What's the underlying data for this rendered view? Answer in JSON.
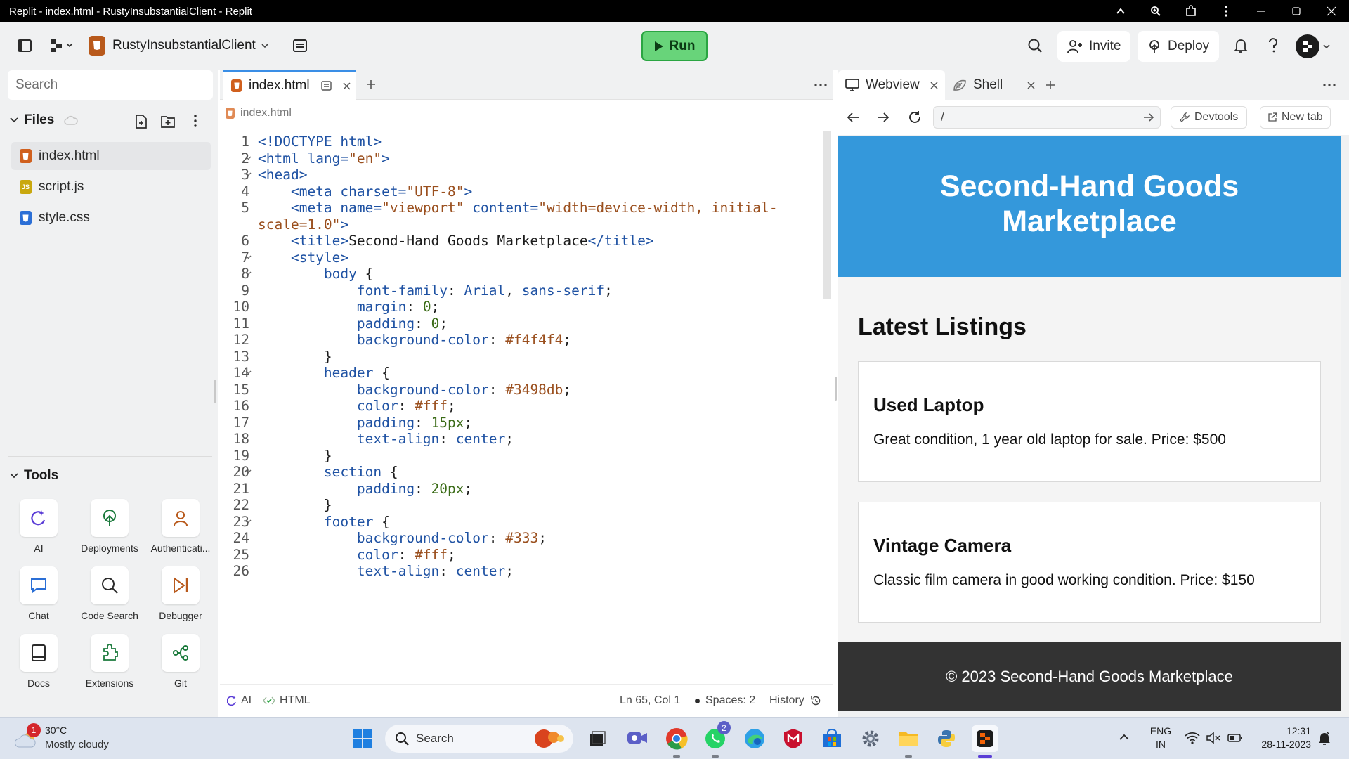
{
  "os": {
    "window_title": "Replit - index.html - RustyInsubstantialClient - Replit"
  },
  "header": {
    "project_name": "RustyInsubstantialClient",
    "run_label": "Run",
    "invite_label": "Invite",
    "deploy_label": "Deploy"
  },
  "sidebar": {
    "search_placeholder": "Search",
    "files_label": "Files",
    "files": [
      {
        "name": "index.html",
        "type": "html"
      },
      {
        "name": "script.js",
        "type": "js"
      },
      {
        "name": "style.css",
        "type": "css"
      }
    ],
    "tools_label": "Tools",
    "tools": [
      {
        "label": "AI",
        "icon": "ai-icon"
      },
      {
        "label": "Deployments",
        "icon": "deployments-icon"
      },
      {
        "label": "Authenticati...",
        "icon": "authentication-icon"
      },
      {
        "label": "Chat",
        "icon": "chat-icon"
      },
      {
        "label": "Code Search",
        "icon": "code-search-icon"
      },
      {
        "label": "Debugger",
        "icon": "debugger-icon"
      },
      {
        "label": "Docs",
        "icon": "docs-icon"
      },
      {
        "label": "Extensions",
        "icon": "extensions-icon"
      },
      {
        "label": "Git",
        "icon": "git-icon"
      }
    ]
  },
  "editor": {
    "tab_label": "index.html",
    "breadcrumb": "index.html",
    "lines": [
      {
        "n": "1",
        "fold": false
      },
      {
        "n": "2",
        "fold": true
      },
      {
        "n": "3",
        "fold": true
      },
      {
        "n": "4",
        "fold": false
      },
      {
        "n": "5",
        "fold": false
      },
      {
        "n": "",
        "fold": false
      },
      {
        "n": "6",
        "fold": false
      },
      {
        "n": "7",
        "fold": true
      },
      {
        "n": "8",
        "fold": true
      },
      {
        "n": "9",
        "fold": false
      },
      {
        "n": "10",
        "fold": false
      },
      {
        "n": "11",
        "fold": false
      },
      {
        "n": "12",
        "fold": false
      },
      {
        "n": "13",
        "fold": false
      },
      {
        "n": "14",
        "fold": true
      },
      {
        "n": "15",
        "fold": false
      },
      {
        "n": "16",
        "fold": false
      },
      {
        "n": "17",
        "fold": false
      },
      {
        "n": "18",
        "fold": false
      },
      {
        "n": "19",
        "fold": false
      },
      {
        "n": "20",
        "fold": true
      },
      {
        "n": "21",
        "fold": false
      },
      {
        "n": "22",
        "fold": false
      },
      {
        "n": "23",
        "fold": true
      },
      {
        "n": "24",
        "fold": false
      },
      {
        "n": "25",
        "fold": false
      },
      {
        "n": "26",
        "fold": false
      }
    ],
    "code": [
      [
        [
          "tag",
          "<!DOCTYPE html>"
        ]
      ],
      [
        [
          "tag",
          "<html "
        ],
        [
          "attr",
          "lang="
        ],
        [
          "str",
          "\"en\""
        ],
        [
          "tag",
          ">"
        ]
      ],
      [
        [
          "tag",
          "<head>"
        ]
      ],
      [
        [
          "txt",
          "    "
        ],
        [
          "tag",
          "<meta "
        ],
        [
          "attr",
          "charset="
        ],
        [
          "str",
          "\"UTF-8\""
        ],
        [
          "tag",
          ">"
        ]
      ],
      [
        [
          "txt",
          "    "
        ],
        [
          "tag",
          "<meta "
        ],
        [
          "attr",
          "name="
        ],
        [
          "str",
          "\"viewport\" "
        ],
        [
          "attr",
          "content="
        ],
        [
          "str",
          "\"width=device-width, initial-"
        ]
      ],
      [
        [
          "str",
          "scale=1.0\""
        ],
        [
          "tag",
          ">"
        ]
      ],
      [
        [
          "txt",
          "    "
        ],
        [
          "tag",
          "<title>"
        ],
        [
          "txt",
          "Second-Hand Goods Marketplace"
        ],
        [
          "tag",
          "</title>"
        ]
      ],
      [
        [
          "txt",
          "    "
        ],
        [
          "tag",
          "<style>"
        ]
      ],
      [
        [
          "txt",
          "        "
        ],
        [
          "sel",
          "body"
        ],
        [
          "txt",
          " {"
        ]
      ],
      [
        [
          "txt",
          "            "
        ],
        [
          "prop",
          "font-family"
        ],
        [
          "txt",
          ": "
        ],
        [
          "prop",
          "Arial"
        ],
        [
          "txt",
          ", "
        ],
        [
          "prop",
          "sans-serif"
        ],
        [
          "txt",
          ";"
        ]
      ],
      [
        [
          "txt",
          "            "
        ],
        [
          "prop",
          "margin"
        ],
        [
          "txt",
          ": "
        ],
        [
          "num",
          "0"
        ],
        [
          "txt",
          ";"
        ]
      ],
      [
        [
          "txt",
          "            "
        ],
        [
          "prop",
          "padding"
        ],
        [
          "txt",
          ": "
        ],
        [
          "num",
          "0"
        ],
        [
          "txt",
          ";"
        ]
      ],
      [
        [
          "txt",
          "            "
        ],
        [
          "prop",
          "background-color"
        ],
        [
          "txt",
          ": "
        ],
        [
          "str",
          "#f4f4f4"
        ],
        [
          "txt",
          ";"
        ]
      ],
      [
        [
          "txt",
          "        }"
        ]
      ],
      [
        [
          "txt",
          "        "
        ],
        [
          "sel",
          "header"
        ],
        [
          "txt",
          " {"
        ]
      ],
      [
        [
          "txt",
          "            "
        ],
        [
          "prop",
          "background-color"
        ],
        [
          "txt",
          ": "
        ],
        [
          "str",
          "#3498db"
        ],
        [
          "txt",
          ";"
        ]
      ],
      [
        [
          "txt",
          "            "
        ],
        [
          "prop",
          "color"
        ],
        [
          "txt",
          ": "
        ],
        [
          "str",
          "#fff"
        ],
        [
          "txt",
          ";"
        ]
      ],
      [
        [
          "txt",
          "            "
        ],
        [
          "prop",
          "padding"
        ],
        [
          "txt",
          ": "
        ],
        [
          "num",
          "15px"
        ],
        [
          "txt",
          ";"
        ]
      ],
      [
        [
          "txt",
          "            "
        ],
        [
          "prop",
          "text-align"
        ],
        [
          "txt",
          ": "
        ],
        [
          "prop",
          "center"
        ],
        [
          "txt",
          ";"
        ]
      ],
      [
        [
          "txt",
          "        }"
        ]
      ],
      [
        [
          "txt",
          "        "
        ],
        [
          "sel",
          "section"
        ],
        [
          "txt",
          " {"
        ]
      ],
      [
        [
          "txt",
          "            "
        ],
        [
          "prop",
          "padding"
        ],
        [
          "txt",
          ": "
        ],
        [
          "num",
          "20px"
        ],
        [
          "txt",
          ";"
        ]
      ],
      [
        [
          "txt",
          "        }"
        ]
      ],
      [
        [
          "txt",
          "        "
        ],
        [
          "sel",
          "footer"
        ],
        [
          "txt",
          " {"
        ]
      ],
      [
        [
          "txt",
          "            "
        ],
        [
          "prop",
          "background-color"
        ],
        [
          "txt",
          ": "
        ],
        [
          "str",
          "#333"
        ],
        [
          "txt",
          ";"
        ]
      ],
      [
        [
          "txt",
          "            "
        ],
        [
          "prop",
          "color"
        ],
        [
          "txt",
          ": "
        ],
        [
          "str",
          "#fff"
        ],
        [
          "txt",
          ";"
        ]
      ],
      [
        [
          "txt",
          "            "
        ],
        [
          "prop",
          "text-align"
        ],
        [
          "txt",
          ": "
        ],
        [
          "prop",
          "center"
        ],
        [
          "txt",
          ";"
        ]
      ]
    ],
    "status": {
      "ai": "AI",
      "language": "HTML",
      "cursor": "Ln 65, Col 1",
      "spaces": "Spaces: 2",
      "history": "History"
    }
  },
  "webview": {
    "tab_webview": "Webview",
    "tab_shell": "Shell",
    "url": "/",
    "devtools_label": "Devtools",
    "newtab_label": "New tab",
    "site": {
      "header_title": "Second-Hand Goods Marketplace",
      "section_title": "Latest Listings",
      "listings": [
        {
          "title": "Used Laptop",
          "desc": "Great condition, 1 year old laptop for sale. Price: $500"
        },
        {
          "title": "Vintage Camera",
          "desc": "Classic film camera in good working condition. Price: $150"
        }
      ],
      "footer": "© 2023 Second-Hand Goods Marketplace",
      "colors": {
        "header": "#3498db",
        "footer": "#333333",
        "background": "#f4f4f4"
      }
    }
  },
  "taskbar": {
    "weather_temp": "30°C",
    "weather_desc": "Mostly cloudy",
    "weather_badge": "1",
    "search_label": "Search",
    "whatsapp_badge": "2",
    "lang_top": "ENG",
    "lang_bottom": "IN",
    "time": "12:31",
    "date": "28-11-2023"
  },
  "colors": {
    "accent": "#3a8ee6",
    "run_green": "#68d47a"
  }
}
